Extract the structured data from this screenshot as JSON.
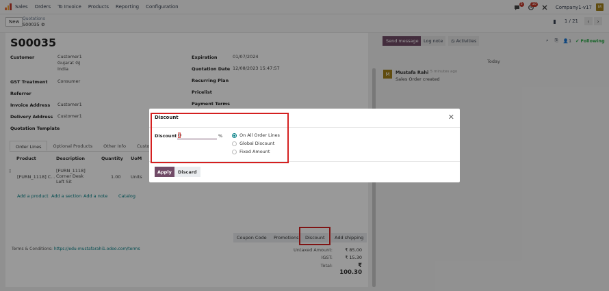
{
  "nav": {
    "items": [
      "Sales",
      "Orders",
      "To Invoice",
      "Products",
      "Reporting",
      "Configuration"
    ],
    "badge_messages": "5",
    "badge_activities": "10",
    "company": "Company1-v17",
    "avatar": "M"
  },
  "control": {
    "new_label": "New",
    "breadcrumb_parent": "Quotations",
    "breadcrumb_current": "S00035",
    "pager": "1 / 21"
  },
  "form": {
    "name": "S00035",
    "customer_label": "Customer",
    "customer_lines": [
      "Customer1",
      "Gujarat GJ",
      "India"
    ],
    "gst_label": "GST Treatment",
    "gst_value": "Consumer",
    "referrer_label": "Referrer",
    "invoice_label": "Invoice Address",
    "invoice_value": "Customer1",
    "delivery_label": "Delivery Address",
    "delivery_value": "Customer1",
    "template_label": "Quotation Template",
    "expiration_label": "Expiration",
    "expiration_value": "01/07/2024",
    "qdate_label": "Quotation Date",
    "qdate_value": "12/08/2023 15:47:57",
    "recurring_label": "Recurring Plan",
    "pricelist_label": "Pricelist",
    "payment_label": "Payment Terms"
  },
  "tabs": [
    "Order Lines",
    "Optional Products",
    "Other Info",
    "Customer"
  ],
  "table": {
    "headers": [
      "Product",
      "Description",
      "Quantity",
      "UoM"
    ],
    "row": {
      "product": "[FURN_1118] C...",
      "description": [
        "[FURN_1118]",
        "Corner Desk",
        "Left Sit"
      ],
      "quantity": "1.00",
      "uom": "Units"
    }
  },
  "links": [
    "Add a product",
    "Add a section",
    "Add a note",
    "Catalog"
  ],
  "buttons": {
    "coupon": "Coupon Code",
    "promotions": "Promotions",
    "discount": "Discount",
    "shipping": "Add shipping"
  },
  "terms": {
    "label": "Terms & Conditions:",
    "link": "https://edu-mustafarahi1.odoo.com/terms"
  },
  "totals": {
    "untaxed_label": "Untaxed Amount:",
    "untaxed_value": "₹ 85.00",
    "igst_label": "IGST:",
    "igst_value": "₹ 15.30",
    "total_label": "Total:",
    "total_value": "₹ 100.30"
  },
  "chatter": {
    "send": "Send message",
    "log": "Log note",
    "activities": "Activities",
    "followers": "1",
    "following": "Following",
    "today": "Today",
    "author": "Mustafa Rahi",
    "time": "- 5 minutes ago",
    "body": "Sales Order created",
    "avatar": "M"
  },
  "modal": {
    "title": "Discount",
    "field_label": "Discount",
    "value": "0",
    "unit": "%",
    "options": [
      "On All Order Lines",
      "Global Discount",
      "Fixed Amount"
    ],
    "selected": "On All Order Lines",
    "apply": "Apply",
    "discard": "Discard"
  },
  "colors": {
    "brand": "#714b67",
    "accent": "#017e84",
    "highlight": "#d42020"
  }
}
